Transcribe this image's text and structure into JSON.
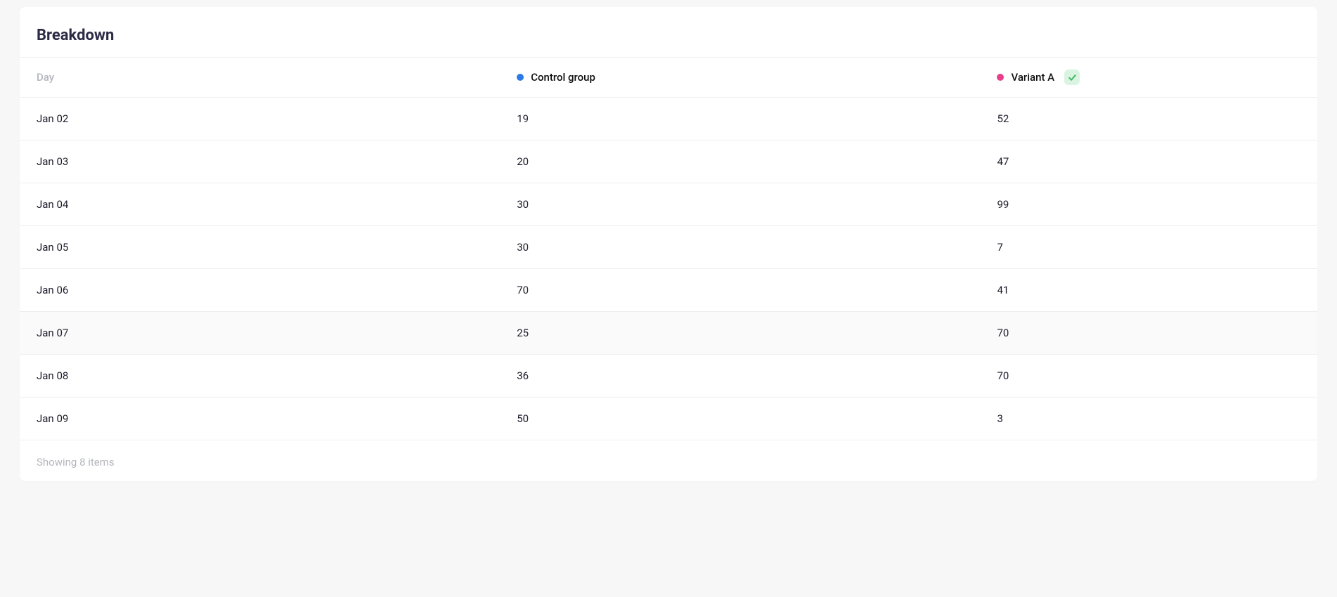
{
  "title": "Breakdown",
  "columns": {
    "day_label": "Day",
    "series": [
      {
        "label": "Control group",
        "color": "#2c7be5"
      },
      {
        "label": "Variant A",
        "color": "#e83e8c",
        "winner": true
      }
    ]
  },
  "rows": [
    {
      "day": "Jan 02",
      "control": "19",
      "variant_a": "52",
      "alt": false
    },
    {
      "day": "Jan 03",
      "control": "20",
      "variant_a": "47",
      "alt": false
    },
    {
      "day": "Jan 04",
      "control": "30",
      "variant_a": "99",
      "alt": false
    },
    {
      "day": "Jan 05",
      "control": "30",
      "variant_a": "7",
      "alt": false
    },
    {
      "day": "Jan 06",
      "control": "70",
      "variant_a": "41",
      "alt": false
    },
    {
      "day": "Jan 07",
      "control": "25",
      "variant_a": "70",
      "alt": true
    },
    {
      "day": "Jan 08",
      "control": "36",
      "variant_a": "70",
      "alt": false
    },
    {
      "day": "Jan 09",
      "control": "50",
      "variant_a": "3",
      "alt": false
    }
  ],
  "footer": "Showing 8 items",
  "chart_data": {
    "type": "table",
    "title": "Breakdown",
    "categories": [
      "Jan 02",
      "Jan 03",
      "Jan 04",
      "Jan 05",
      "Jan 06",
      "Jan 07",
      "Jan 08",
      "Jan 09"
    ],
    "series": [
      {
        "name": "Control group",
        "values": [
          19,
          20,
          30,
          30,
          70,
          25,
          36,
          50
        ]
      },
      {
        "name": "Variant A",
        "values": [
          52,
          47,
          99,
          7,
          41,
          70,
          70,
          3
        ]
      }
    ],
    "xlabel": "Day",
    "ylabel": ""
  }
}
